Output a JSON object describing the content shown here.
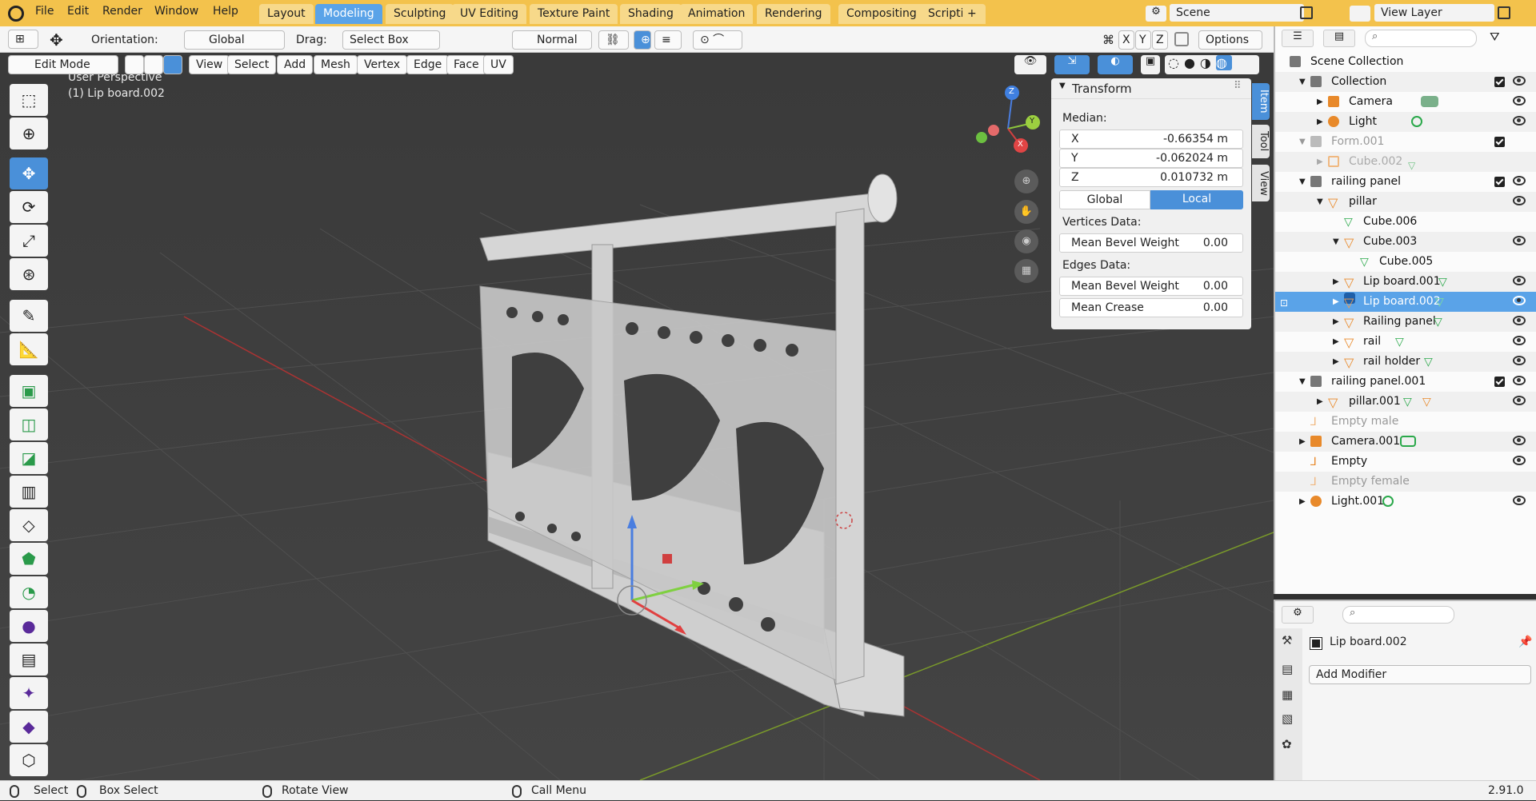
{
  "topbar": {
    "menus": [
      "File",
      "Edit",
      "Render",
      "Window",
      "Help"
    ],
    "workspaces": [
      "Layout",
      "Modeling",
      "Sculpting",
      "UV Editing",
      "Texture Paint",
      "Shading",
      "Animation",
      "Rendering",
      "Compositing",
      "Scripting"
    ],
    "active_workspace": "Modeling",
    "add_tab": "+",
    "scene_label": "Scene",
    "view_layer_label": "View Layer"
  },
  "header": {
    "orientation_label": "Orientation:",
    "orientation_value": "Global",
    "drag_label": "Drag:",
    "drag_value": "Select Box",
    "pivot_value": "Normal",
    "axis_x": "X",
    "axis_y": "Y",
    "axis_z": "Z",
    "options_label": "Options"
  },
  "header2": {
    "mode": "Edit Mode",
    "menus": [
      "View",
      "Select",
      "Add",
      "Mesh",
      "Vertex",
      "Edge",
      "Face",
      "UV"
    ]
  },
  "viewport": {
    "perspective": "User Perspective",
    "object_info": "(1) Lip board.002",
    "gizmo_x": "X",
    "gizmo_y": "Y",
    "gizmo_z": "Z"
  },
  "npanel": {
    "title": "Transform",
    "median_label": "Median:",
    "x_label": "X",
    "x_value": "-0.66354 m",
    "y_label": "Y",
    "y_value": "-0.062024 m",
    "z_label": "Z",
    "z_value": "0.010732 m",
    "global_label": "Global",
    "local_label": "Local",
    "vertices_data_label": "Vertices Data:",
    "v_bevel_label": "Mean Bevel Weight",
    "v_bevel_value": "0.00",
    "edges_data_label": "Edges Data:",
    "e_bevel_label": "Mean Bevel Weight",
    "e_bevel_value": "0.00",
    "crease_label": "Mean Crease",
    "crease_value": "0.00",
    "tabs": [
      "Item",
      "Tool",
      "View"
    ]
  },
  "outliner": {
    "rows": [
      {
        "label": "Scene Collection"
      },
      {
        "label": "Collection"
      },
      {
        "label": "Camera"
      },
      {
        "label": "Light"
      },
      {
        "label": "Form.001"
      },
      {
        "label": "Cube.002"
      },
      {
        "label": "railing panel"
      },
      {
        "label": "pillar"
      },
      {
        "label": "Cube.006"
      },
      {
        "label": "Cube.003"
      },
      {
        "label": "Cube.005"
      },
      {
        "label": "Lip board.001"
      },
      {
        "label": "Lip board.002"
      },
      {
        "label": "Railing panel"
      },
      {
        "label": "rail"
      },
      {
        "label": "rail holder"
      },
      {
        "label": "railing panel.001"
      },
      {
        "label": "pillar.001"
      },
      {
        "label": "Empty male"
      },
      {
        "label": "Camera.001"
      },
      {
        "label": "Empty"
      },
      {
        "label": "Empty female"
      },
      {
        "label": "Light.001"
      }
    ]
  },
  "properties": {
    "object_name": "Lip board.002",
    "add_modifier": "Add Modifier"
  },
  "status": {
    "select": "Select",
    "box_select": "Box Select",
    "rotate_view": "Rotate View",
    "call_menu": "Call Menu",
    "version": "2.91.0"
  },
  "colors": {
    "topbar": "#f3c24c",
    "accent": "#5aa3e8",
    "object_orange": "#e8892a",
    "mesh_green": "#2aa84a"
  }
}
